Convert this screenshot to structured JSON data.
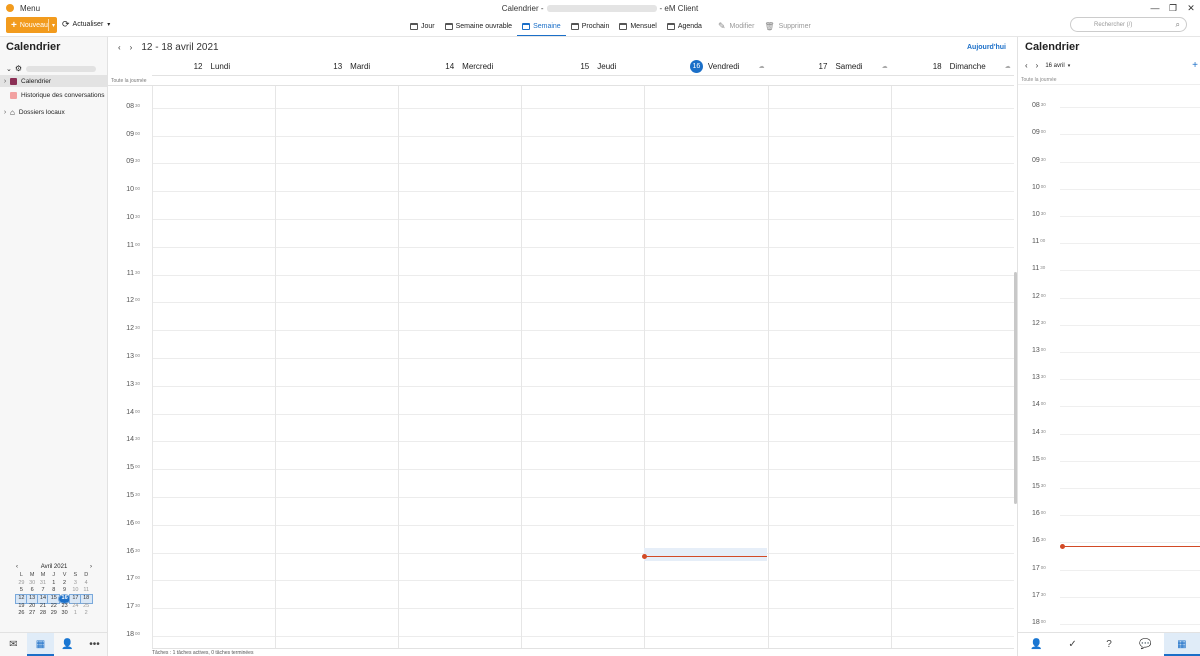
{
  "window": {
    "title_prefix": "Calendrier -",
    "title_suffix": "- eM Client",
    "menu_label": "Menu",
    "minimize": "—",
    "maximize": "❐",
    "close": "✕"
  },
  "toolbar": {
    "new_label": "Nouveau",
    "sync_label": "Actualiser",
    "views": [
      {
        "label": "Jour",
        "active": false
      },
      {
        "label": "Semaine ouvrable",
        "active": false
      },
      {
        "label": "Semaine",
        "active": true
      },
      {
        "label": "Prochain",
        "active": false
      },
      {
        "label": "Mensuel",
        "active": false
      },
      {
        "label": "Agenda",
        "active": false
      }
    ],
    "edit_label": "Modifier",
    "delete_label": "Supprimer",
    "search_placeholder": "Rechercher (/)"
  },
  "sidebar": {
    "title": "Calendrier",
    "items": [
      {
        "label": "Calendrier",
        "color": "#8b2f55"
      },
      {
        "label": "Historique des conversations",
        "color": "#f2a1a1"
      },
      {
        "label": "Dossiers locaux"
      }
    ],
    "minical": {
      "month": "Avril 2021",
      "weekday_headers": [
        "L",
        "M",
        "M",
        "J",
        "V",
        "S",
        "D"
      ],
      "weeks": [
        [
          "29",
          "30",
          "31",
          "1",
          "2",
          "3",
          "4"
        ],
        [
          "5",
          "6",
          "7",
          "8",
          "9",
          "10",
          "11"
        ],
        [
          "12",
          "13",
          "14",
          "15",
          "16",
          "17",
          "18"
        ],
        [
          "19",
          "20",
          "21",
          "22",
          "23",
          "24",
          "25"
        ],
        [
          "26",
          "27",
          "28",
          "29",
          "30",
          "1",
          "2"
        ]
      ]
    }
  },
  "main": {
    "range": "12 - 18 avril 2021",
    "today_label": "Aujourd'hui",
    "allday_label": "Toute la journée",
    "days": [
      {
        "num": "12",
        "name": "Lundi",
        "today": false
      },
      {
        "num": "13",
        "name": "Mardi",
        "today": false
      },
      {
        "num": "14",
        "name": "Mercredi",
        "today": false
      },
      {
        "num": "15",
        "name": "Jeudi",
        "today": false
      },
      {
        "num": "16",
        "name": "Vendredi",
        "today": true
      },
      {
        "num": "17",
        "name": "Samedi",
        "today": false
      },
      {
        "num": "18",
        "name": "Dimanche",
        "today": false
      }
    ],
    "time_labels": [
      [
        "08",
        "00"
      ],
      [
        "08",
        "30"
      ],
      [
        "09",
        "00"
      ],
      [
        "09",
        "30"
      ],
      [
        "10",
        "00"
      ],
      [
        "10",
        "30"
      ],
      [
        "11",
        "00"
      ],
      [
        "11",
        "30"
      ],
      [
        "12",
        "00"
      ],
      [
        "12",
        "30"
      ],
      [
        "13",
        "00"
      ],
      [
        "13",
        "30"
      ],
      [
        "14",
        "00"
      ],
      [
        "14",
        "30"
      ],
      [
        "15",
        "00"
      ],
      [
        "15",
        "30"
      ],
      [
        "16",
        "00"
      ],
      [
        "16",
        "30"
      ],
      [
        "17",
        "00"
      ],
      [
        "17",
        "30"
      ],
      [
        "18",
        "00"
      ]
    ],
    "status": "Tâches : 1 tâches actives, 0 tâches terminées"
  },
  "right": {
    "title": "Calendrier",
    "date": "16 avril",
    "allday_label": "Toute la journée",
    "time_labels": [
      [
        "08",
        "00"
      ],
      [
        "08",
        "30"
      ],
      [
        "09",
        "00"
      ],
      [
        "09",
        "30"
      ],
      [
        "10",
        "00"
      ],
      [
        "10",
        "30"
      ],
      [
        "11",
        "00"
      ],
      [
        "11",
        "30"
      ],
      [
        "12",
        "00"
      ],
      [
        "12",
        "30"
      ],
      [
        "13",
        "00"
      ],
      [
        "13",
        "30"
      ],
      [
        "14",
        "00"
      ],
      [
        "14",
        "30"
      ],
      [
        "15",
        "00"
      ],
      [
        "15",
        "30"
      ],
      [
        "16",
        "00"
      ],
      [
        "16",
        "30"
      ],
      [
        "17",
        "00"
      ],
      [
        "17",
        "30"
      ],
      [
        "18",
        "00"
      ]
    ]
  },
  "colors": {
    "accent": "#1b6fc8",
    "new_button": "#f29b1d",
    "now_line": "#d24a26"
  }
}
